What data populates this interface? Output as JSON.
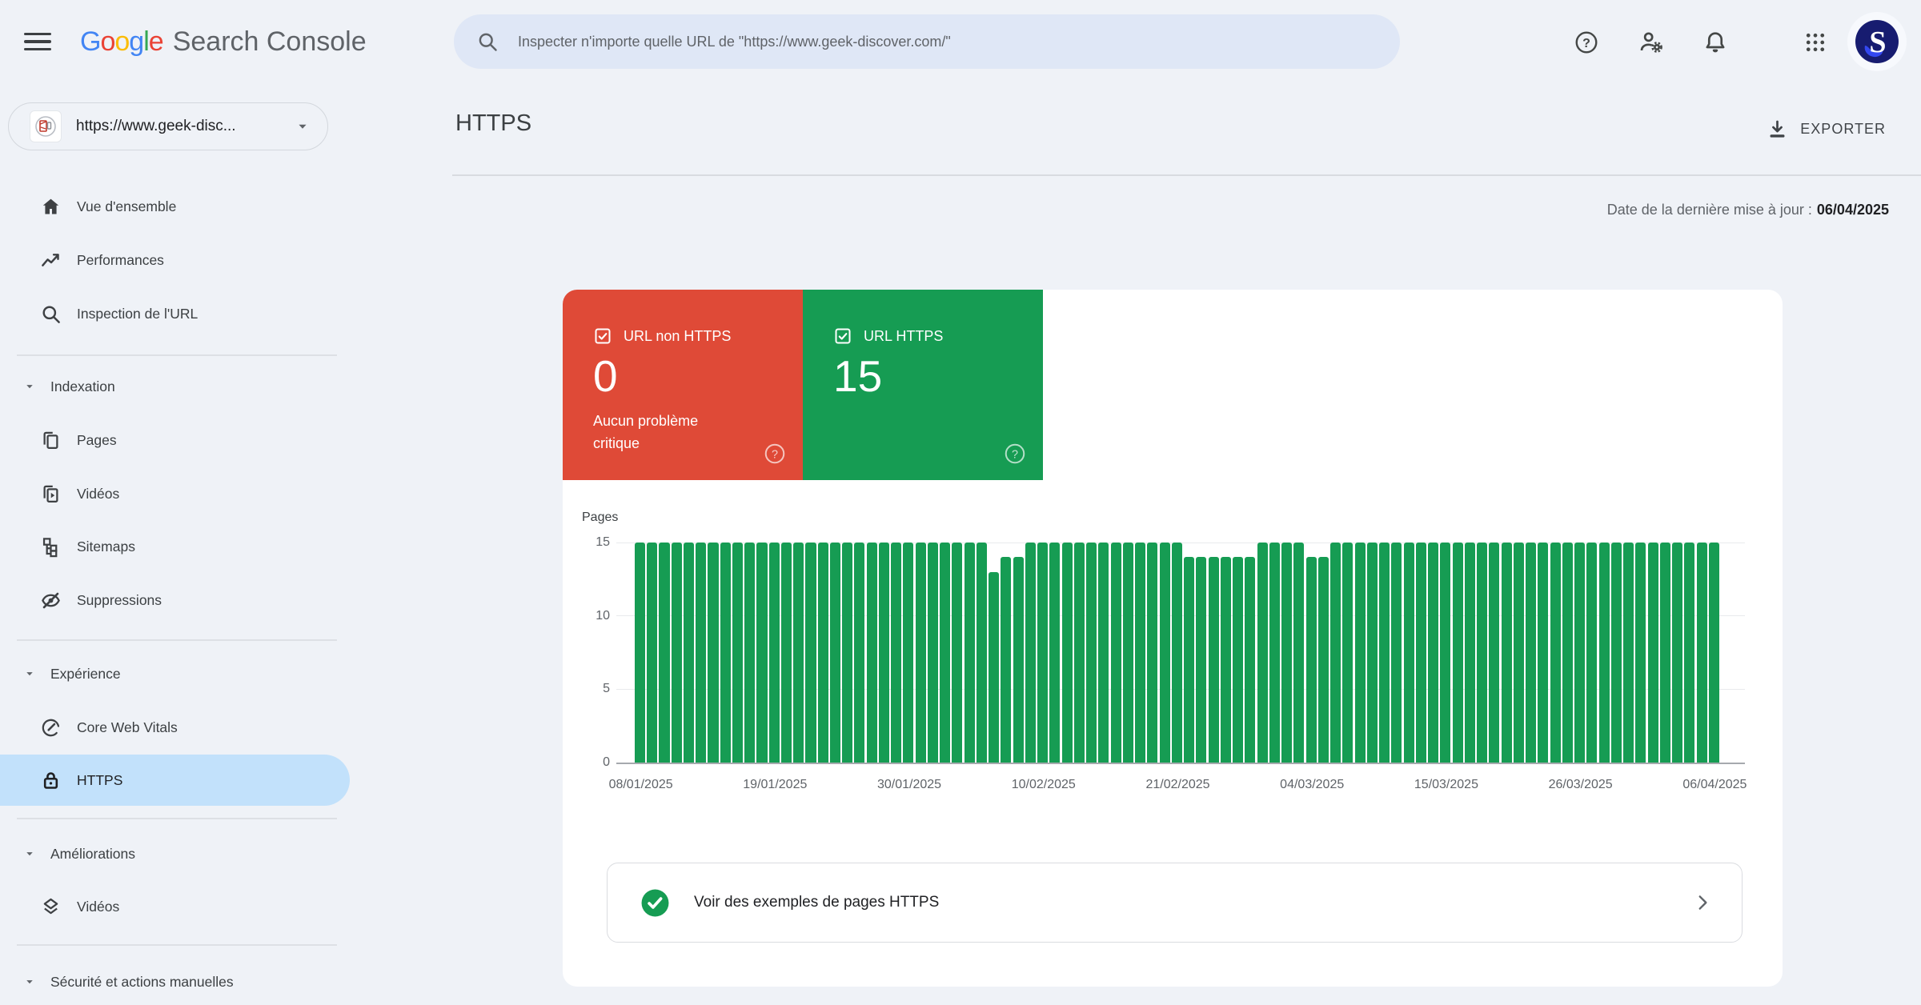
{
  "theme": {
    "background": "#eff2f7",
    "search_pill": "#dfe7f6",
    "selected_nav": "#c2e1fb",
    "card_red": "#df4a37",
    "card_green": "#169c53",
    "bar_green": "#169c53",
    "text_primary": "#202124",
    "text_secondary": "#5f6368",
    "logo_colors": [
      "#4285F4",
      "#EA4335",
      "#FBBC05",
      "#4285F4",
      "#34A853",
      "#EA4335"
    ]
  },
  "header": {
    "logo_google": "Google",
    "logo_product": "Search Console",
    "search_placeholder": "Inspecter n'importe quelle URL de \"https://www.geek-discover.com/\"",
    "icons": [
      "menu-icon",
      "search-icon",
      "help-icon",
      "user-settings-icon",
      "notifications-icon",
      "apps-grid-icon",
      "avatar"
    ],
    "avatar_letter": "S"
  },
  "sidebar": {
    "property_selector": {
      "label": "https://www.geek-disc..."
    },
    "top_items": {
      "overview": "Vue d'ensemble",
      "performance": "Performances",
      "url_inspection": "Inspection de l'URL"
    },
    "indexation": {
      "title": "Indexation",
      "pages": "Pages",
      "videos": "Vidéos",
      "sitemaps": "Sitemaps",
      "removals": "Suppressions"
    },
    "experience": {
      "title": "Expérience",
      "core_web_vitals": "Core Web Vitals",
      "https": "HTTPS"
    },
    "enhancements": {
      "title": "Améliorations",
      "videos": "Vidéos"
    },
    "security": {
      "title": "Sécurité et actions manuelles"
    }
  },
  "main": {
    "title": "HTTPS",
    "export_label": "EXPORTER",
    "last_update_label": "Date de la dernière mise à jour :",
    "last_update_value": "06/04/2025",
    "cards": {
      "non_https": {
        "title": "URL non HTTPS",
        "value": "0",
        "subtitle": "Aucun problème critique"
      },
      "https": {
        "title": "URL HTTPS",
        "value": "15"
      }
    },
    "example_link": {
      "label": "Voir des exemples de pages HTTPS"
    }
  },
  "chart_data": {
    "type": "bar",
    "title": "",
    "ylabel": "Pages",
    "ylim": [
      0,
      15
    ],
    "y_ticks": [
      15,
      10,
      5,
      0
    ],
    "grid": true,
    "x_start": "08/01/2025",
    "x_end": "06/04/2025",
    "x_tick_labels": [
      "08/01/2025",
      "19/01/2025",
      "30/01/2025",
      "10/02/2025",
      "21/02/2025",
      "04/03/2025",
      "15/03/2025",
      "26/03/2025",
      "06/04/2025"
    ],
    "bar_color": "#169c53",
    "values": [
      15,
      15,
      15,
      15,
      15,
      15,
      15,
      15,
      15,
      15,
      15,
      15,
      15,
      15,
      15,
      15,
      15,
      15,
      15,
      15,
      15,
      15,
      15,
      15,
      15,
      15,
      15,
      15,
      15,
      13,
      14,
      14,
      15,
      15,
      15,
      15,
      15,
      15,
      15,
      15,
      15,
      15,
      15,
      15,
      15,
      14,
      14,
      14,
      14,
      14,
      14,
      15,
      15,
      15,
      15,
      14,
      14,
      15,
      15,
      15,
      15,
      15,
      15,
      15,
      15,
      15,
      15,
      15,
      15,
      15,
      15,
      15,
      15,
      15,
      15,
      15,
      15,
      15,
      15,
      15,
      15,
      15,
      15,
      15,
      15,
      15,
      15,
      15,
      15
    ]
  }
}
